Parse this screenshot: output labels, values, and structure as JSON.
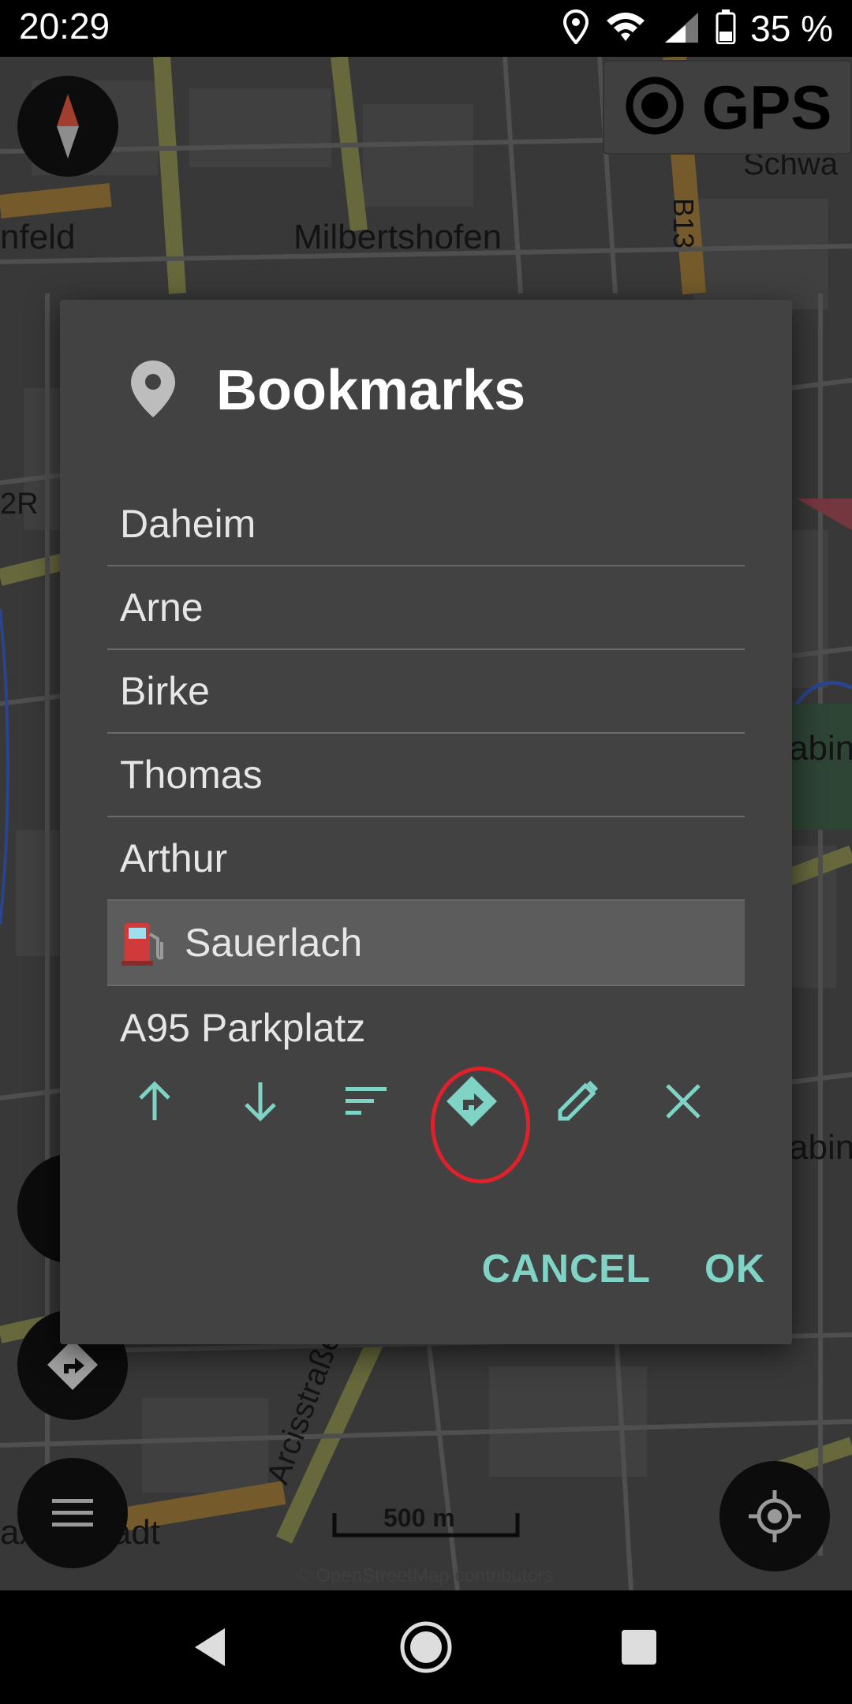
{
  "status_bar": {
    "time": "20:29",
    "battery_percent": "35 %",
    "icons": [
      "location-icon",
      "wifi-icon",
      "signal-icon",
      "battery-icon"
    ]
  },
  "map": {
    "labels": {
      "milbertshofen": "Milbertshofen",
      "nfeld": "nfeld",
      "schwa": "Schwa",
      "b13": "B13",
      "two_r": "2R",
      "abin_1": "abin",
      "abin_2": "abin",
      "arcisstrasse": "Arcisstraße",
      "axvorstadt": "axvorstadt"
    },
    "gps_label": "GPS",
    "scale_label": "500 m",
    "credit": "© OpenStreetMap contributors"
  },
  "dialog": {
    "title": "Bookmarks",
    "title_icon": "location-pin-icon",
    "items": [
      {
        "label": "Daheim"
      },
      {
        "label": "Arne"
      },
      {
        "label": "Birke"
      },
      {
        "label": "Thomas"
      },
      {
        "label": "Arthur"
      },
      {
        "label": "Sauerlach",
        "icon": "fuel-pump-icon",
        "selected": true
      },
      {
        "label": "A95 Parkplatz"
      }
    ],
    "toolbar": [
      "move-up-icon",
      "move-down-icon",
      "sort-icon",
      "navigate-icon",
      "edit-icon",
      "delete-icon"
    ],
    "cancel_label": "CANCEL",
    "ok_label": "OK"
  },
  "colors": {
    "accent": "#7fd4c6",
    "dialog_bg": "#424242",
    "selected_bg": "#5c5c5c",
    "highlight_ring": "#e0202a"
  }
}
